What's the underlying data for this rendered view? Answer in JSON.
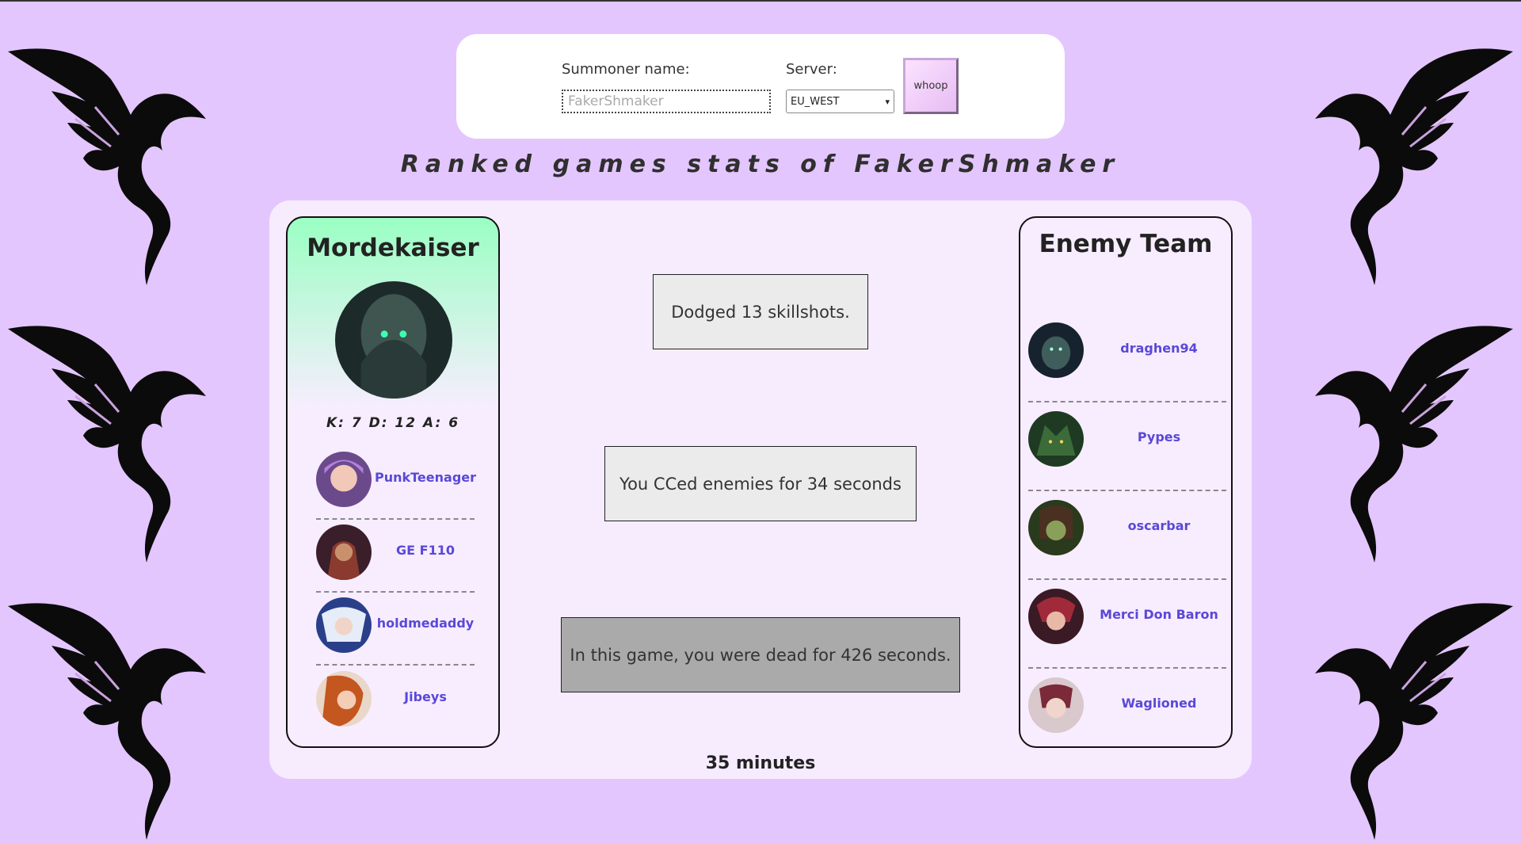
{
  "search": {
    "name_label": "Summoner name:",
    "name_placeholder": "FakerShmaker",
    "server_label": "Server:",
    "server_value": "EU_WEST",
    "submit_label": "whoop"
  },
  "heading": "Ranked games stats of FakerShmaker",
  "my_team": {
    "champion": "Mordekaiser",
    "kda": "K: 7 D: 12 A: 6",
    "allies": [
      {
        "name": "PunkTeenager"
      },
      {
        "name": "GE F110"
      },
      {
        "name": "holdmedaddy"
      },
      {
        "name": "Jibeys"
      }
    ]
  },
  "stats": {
    "skillshots": "Dodged 13 skillshots.",
    "cc": "You CCed enemies for 34 seconds",
    "dead": "In this game, you were dead for 426 seconds.",
    "duration": "35 minutes"
  },
  "enemy_team": {
    "title": "Enemy Team",
    "players": [
      {
        "name": "draghen94"
      },
      {
        "name": "Pypes"
      },
      {
        "name": "oscarbar"
      },
      {
        "name": "Merci Don Baron"
      },
      {
        "name": "Waglioned"
      }
    ]
  },
  "colors": {
    "background": "#e4c6fe",
    "panel": "#f6ecfd",
    "link": "#5a48d8",
    "my_team_gradient": "#9affc3"
  }
}
